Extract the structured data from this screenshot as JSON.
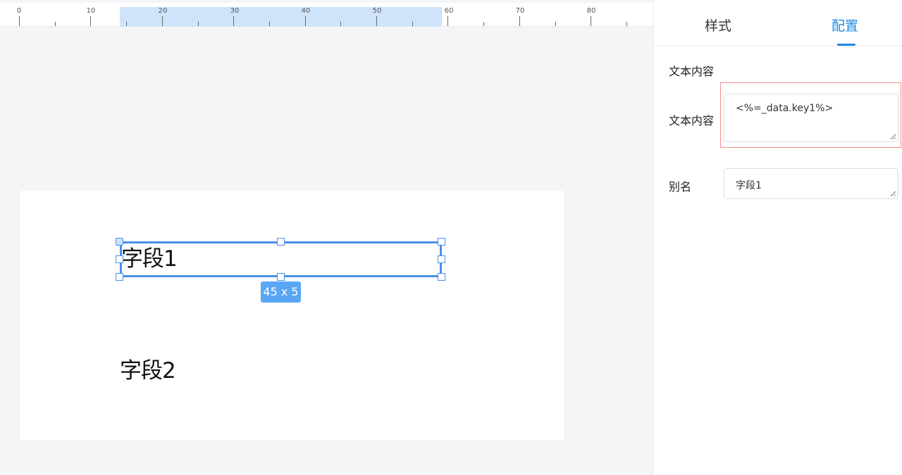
{
  "ruler": {
    "labels": [
      "0",
      "10",
      "20",
      "30",
      "40",
      "50",
      "60",
      "70",
      "80"
    ],
    "highlight_range": [
      14,
      59
    ]
  },
  "canvas": {
    "fields": [
      {
        "text": "字段1"
      },
      {
        "text": "字段2"
      }
    ],
    "selection": {
      "size_label": "45 x 5"
    }
  },
  "panel": {
    "tabs": [
      {
        "label": "样式",
        "active": false
      },
      {
        "label": "配置",
        "active": true
      }
    ],
    "section_title": "文本内容",
    "content_label": "文本内容",
    "content_value": "<%=_data.key1%>",
    "alias_label": "别名",
    "alias_value": "字段1"
  },
  "colors": {
    "accent": "#1e88e5",
    "selection": "#4a8fe6",
    "badge": "#5aa6f5",
    "error_border": "#f28b8b"
  }
}
